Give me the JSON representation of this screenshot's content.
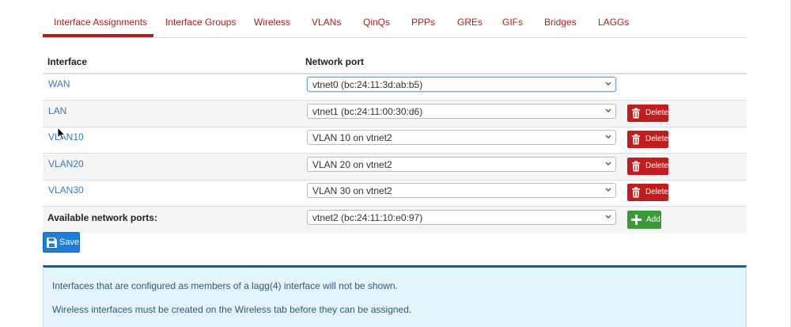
{
  "tabs": [
    {
      "label": "Interface Assignments",
      "active": true
    },
    {
      "label": "Interface Groups"
    },
    {
      "label": "Wireless"
    },
    {
      "label": "VLANs"
    },
    {
      "label": "QinQs"
    },
    {
      "label": "PPPs"
    },
    {
      "label": "GREs"
    },
    {
      "label": "GIFs"
    },
    {
      "label": "Bridges"
    },
    {
      "label": "LAGGs"
    }
  ],
  "table": {
    "headers": {
      "interface": "Interface",
      "network_port": "Network port"
    },
    "rows": [
      {
        "interface": "WAN",
        "port": "vtnet0 (bc:24:11:3d:ab:b5)",
        "delete": ""
      },
      {
        "interface": "LAN",
        "port": "vtnet1 (bc:24:11:00:30:d6)",
        "delete": "Delete"
      },
      {
        "interface": "VLAN10",
        "port": "VLAN 10 on vtnet2",
        "delete": "Delete"
      },
      {
        "interface": "VLAN20",
        "port": "VLAN 20 on vtnet2",
        "delete": "Delete"
      },
      {
        "interface": "VLAN30",
        "port": "VLAN 30 on vtnet2",
        "delete": "Delete"
      }
    ],
    "available": {
      "label": "Available network ports:",
      "port": "vtnet2 (bc:24:11:10:e0:97)",
      "add": "Add"
    }
  },
  "save_label": "Save",
  "info": {
    "line1": "Interfaces that are configured as members of a lagg(4) interface will not be shown.",
    "line2": "Wireless interfaces must be created on the Wireless tab before they can be assigned."
  },
  "colors": {
    "accent": "#b71c1c",
    "link": "#3c7bb0",
    "save": "#1c7ed6",
    "add": "#3a9a3a",
    "info_bg": "#e3f4fb"
  }
}
